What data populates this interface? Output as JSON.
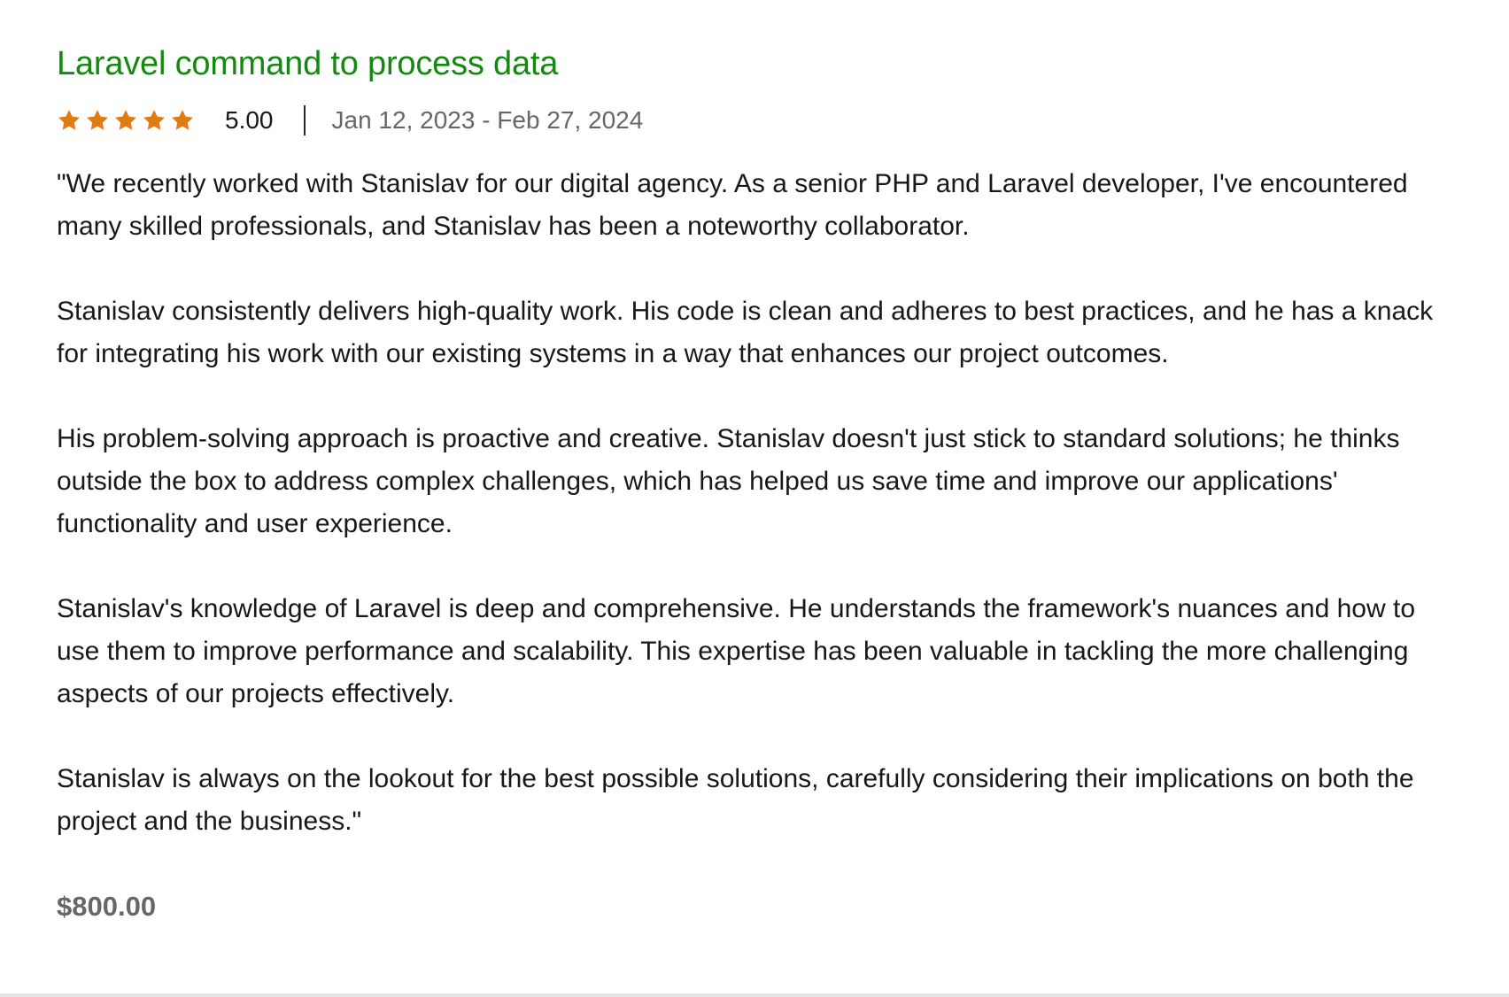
{
  "review": {
    "title": "Laravel command to process data",
    "rating": {
      "stars_filled": 5,
      "stars_total": 5,
      "star_color": "#e07b14",
      "label": "5.00"
    },
    "dates": "Jan 12, 2023 - Feb 27, 2024",
    "paragraphs": [
      "\"We recently worked with Stanislav for our digital agency. As a senior PHP and Laravel developer, I've encountered many skilled professionals, and Stanislav has been a noteworthy collaborator.",
      "Stanislav consistently delivers high-quality work. His code is clean and adheres to best practices, and he has a knack for integrating his work with our existing systems in a way that enhances our project outcomes.",
      "His problem-solving approach is proactive and creative. Stanislav doesn't just stick to standard solutions; he thinks outside the box to address complex challenges, which has helped us save time and improve our applications' functionality and user experience.",
      "Stanislav's knowledge of Laravel is deep and comprehensive. He understands the framework's nuances and how to use them to improve performance and scalability. This expertise has been valuable in tackling the more challenging aspects of our projects effectively.",
      "Stanislav is always on the lookout for the best possible solutions, carefully considering their implications on both the project and the business.\""
    ],
    "price": "$800.00"
  },
  "colors": {
    "title": "#14890f",
    "muted_text": "#676767",
    "body_text": "#181818"
  },
  "icons": [
    "star-icon"
  ]
}
